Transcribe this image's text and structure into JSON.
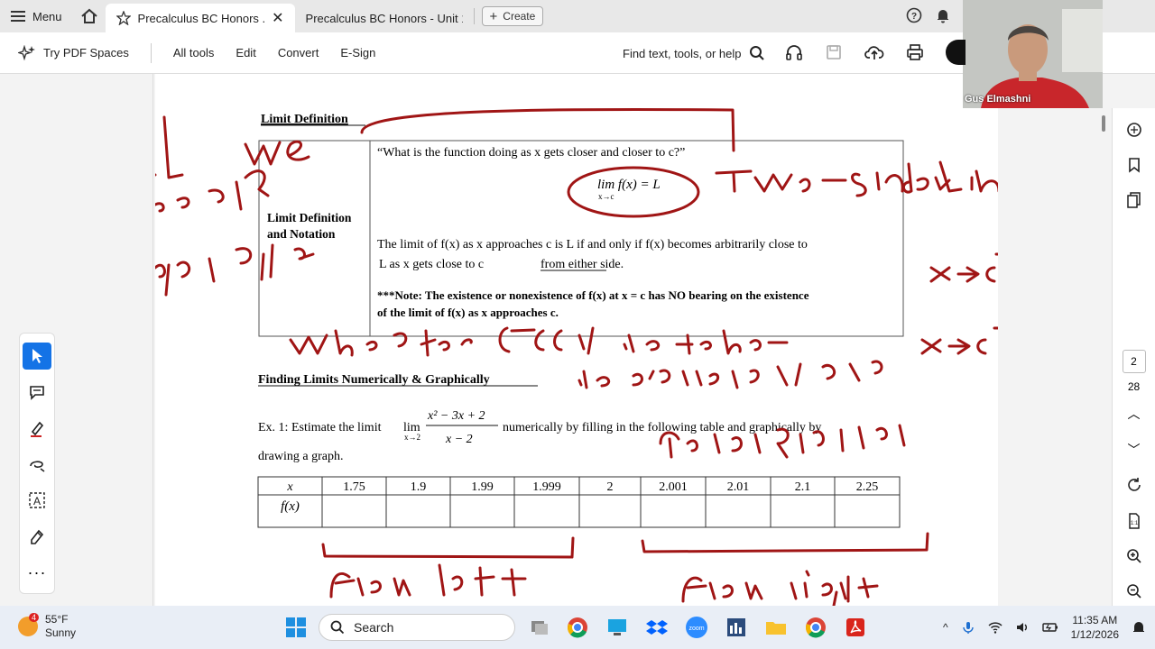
{
  "browser": {
    "menu_label": "Menu",
    "tabs": [
      {
        "title": "Precalculus BC Honors ..."
      },
      {
        "title": "Precalculus BC Honors - Unit 1 ..."
      }
    ],
    "create_label": "Create"
  },
  "toolbar": {
    "pdf_spaces": "Try PDF Spaces",
    "menus": [
      "All tools",
      "Edit",
      "Convert",
      "E-Sign"
    ],
    "find_label": "Find text, tools, or help"
  },
  "video": {
    "participant": "Gus Elmashni"
  },
  "document": {
    "section1_title": "Limit Definition",
    "row_label_line1": "Limit Definition",
    "row_label_line2": "and Notation",
    "quote": "“What is the function doing as x gets closer and closer to c?”",
    "lim_expr": "lim f(x) = L",
    "lim_sub": "x→c",
    "def_line1": "The limit of f(x) as x approaches c is L if and only if f(x) becomes arbitrarily close to",
    "def_line2_a": "L as x gets close to c",
    "def_line2_b": "from either side.",
    "note_line1": "***Note: The existence or nonexistence of f(x) at x = c has NO bearing on the existence",
    "note_line2": "of the limit of f(x) as x approaches c.",
    "section2_title": "Finding Limits Numerically & Graphically",
    "ex1_a": "Ex. 1:  Estimate the limit",
    "ex1_lim": "lim",
    "ex1_sub": "x→2",
    "ex1_num": "x² − 3x + 2",
    "ex1_den": "x − 2",
    "ex1_b": "numerically by filling in the following table and graphically by",
    "ex1_c": "drawing a graph.",
    "table": {
      "headers": [
        "x",
        "1.75",
        "1.9",
        "1.99",
        "1.999",
        "2",
        "2.001",
        "2.01",
        "2.1",
        "2.25"
      ],
      "row_label": "f(x)"
    }
  },
  "rightrail": {
    "current_page": "2",
    "total_pages": "28"
  },
  "taskbar": {
    "weather_temp": "55°F",
    "weather_desc": "Sunny",
    "weather_badge": "4",
    "search_label": "Search",
    "time": "11:35 AM",
    "date": "1/12/2026"
  }
}
